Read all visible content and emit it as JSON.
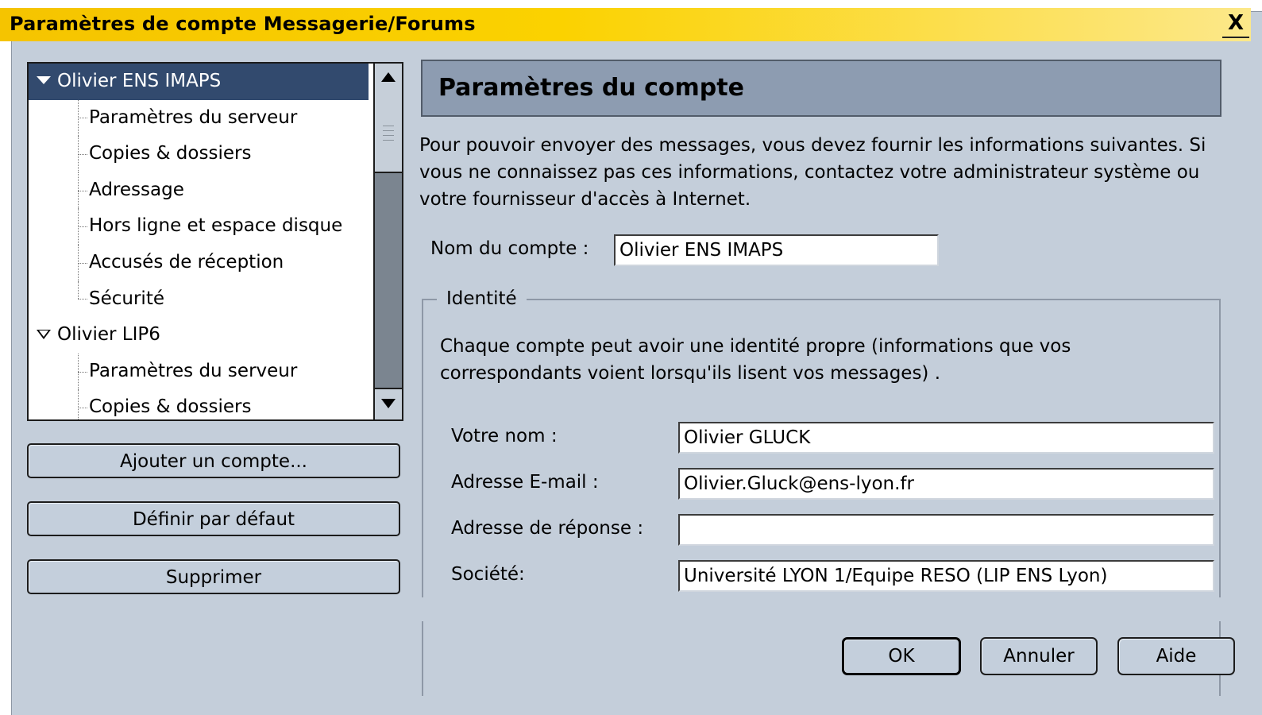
{
  "window": {
    "title": "Paramètres de compte Messagerie/Forums",
    "close_glyph": "X"
  },
  "tree": {
    "items": [
      {
        "label": "Olivier ENS IMAPS",
        "type": "account",
        "selected": true
      },
      {
        "label": "Paramètres du serveur",
        "type": "child"
      },
      {
        "label": "Copies & dossiers",
        "type": "child"
      },
      {
        "label": "Adressage",
        "type": "child"
      },
      {
        "label": "Hors ligne et espace disque",
        "type": "child"
      },
      {
        "label": "Accusés de réception",
        "type": "child"
      },
      {
        "label": "Sécurité",
        "type": "child",
        "last": true
      },
      {
        "label": "Olivier LIP6",
        "type": "account"
      },
      {
        "label": "Paramètres du serveur",
        "type": "child"
      },
      {
        "label": "Copies & dossiers",
        "type": "child"
      }
    ]
  },
  "left_buttons": {
    "add_account": "Ajouter un compte...",
    "set_default": "Définir par défaut",
    "delete": "Supprimer"
  },
  "panel": {
    "title": "Paramètres du compte",
    "description": "Pour pouvoir envoyer des messages, vous devez fournir les informations suivantes. Si vous ne connaissez pas ces informations, contactez votre administrateur système ou votre fournisseur d'accès à Internet.",
    "account_name_label": "Nom du compte :",
    "account_name_value": "Olivier ENS IMAPS"
  },
  "identity": {
    "legend": "Identité",
    "description": "Chaque compte peut avoir une identité propre (informations que vos correspondants voient lorsqu'ils lisent vos messages) .",
    "name_label": "Votre nom :",
    "name_value": "Olivier GLUCK",
    "email_label": "Adresse E-mail :",
    "email_value": "Olivier.Gluck@ens-lyon.fr",
    "reply_label": "Adresse de réponse :",
    "reply_value": "",
    "org_label": "Société:",
    "org_value": "Université LYON 1/Equipe RESO (LIP ENS Lyon)"
  },
  "footer": {
    "ok": "OK",
    "cancel": "Annuler",
    "help": "Aide"
  },
  "colors": {
    "title_bar": "#f5c400",
    "dialog_bg": "#c4ceda",
    "selection": "#324a6e",
    "panel_header": "#8d9cb1"
  }
}
